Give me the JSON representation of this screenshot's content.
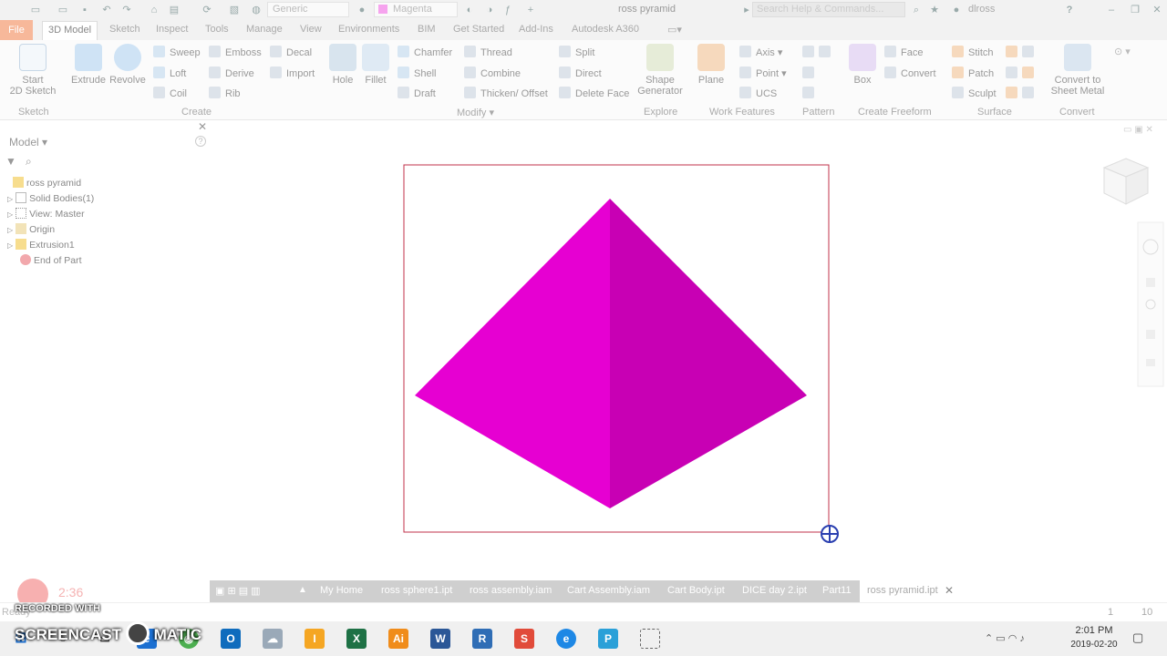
{
  "titlebar": {
    "appearance": "Generic",
    "material": "Magenta",
    "doc_title": "ross pyramid",
    "search_placeholder": "Search Help & Commands...",
    "user": "dlross",
    "help": "?"
  },
  "tabs": [
    "File",
    "3D Model",
    "Sketch",
    "Inspect",
    "Tools",
    "Manage",
    "View",
    "Environments",
    "BIM",
    "Get Started",
    "Add-Ins",
    "Autodesk A360"
  ],
  "ribbon": {
    "sketch": {
      "start_l1": "Start",
      "start_l2": "2D Sketch",
      "group": "Sketch"
    },
    "create": {
      "extrude": "Extrude",
      "revolve": "Revolve",
      "sweep": "Sweep",
      "loft": "Loft",
      "coil": "Coil",
      "emboss": "Emboss",
      "derive": "Derive",
      "rib": "Rib",
      "decal": "Decal",
      "import": "Import",
      "group": "Create"
    },
    "modify": {
      "hole": "Hole",
      "fillet": "Fillet",
      "chamfer": "Chamfer",
      "shell": "Shell",
      "draft": "Draft",
      "thread": "Thread",
      "combine": "Combine",
      "thicken": "Thicken/ Offset",
      "split": "Split",
      "direct": "Direct",
      "delete_face": "Delete Face",
      "group": "Modify"
    },
    "explore": {
      "shape_l1": "Shape",
      "shape_l2": "Generator",
      "group": "Explore"
    },
    "work": {
      "plane": "Plane",
      "axis": "Axis",
      "point": "Point",
      "ucs": "UCS",
      "group": "Work Features"
    },
    "pattern": {
      "group": "Pattern"
    },
    "freeform": {
      "box": "Box",
      "face": "Face",
      "convert": "Convert",
      "group": "Create Freeform"
    },
    "surface": {
      "stitch": "Stitch",
      "patch": "Patch",
      "sculpt": "Sculpt",
      "group": "Surface"
    },
    "convert": {
      "l1": "Convert to",
      "l2": "Sheet Metal",
      "group": "Convert"
    }
  },
  "browser": {
    "title": "Model",
    "nodes": [
      "ross pyramid",
      "Solid Bodies(1)",
      "View: Master",
      "Origin",
      "Extrusion1",
      "End of Part"
    ]
  },
  "colors": {
    "face_left": "#e600d2",
    "face_right": "#c800b4",
    "frame": "#c0304a"
  },
  "doc_tabs": [
    "My Home",
    "ross sphere1.ipt",
    "ross assembly.iam",
    "Cart Assembly.iam",
    "Cart Body.ipt",
    "DICE day 2.ipt",
    "Part11",
    "ross pyramid.ipt"
  ],
  "status": {
    "ready": "Ready",
    "n1": "1",
    "n2": "10"
  },
  "watermark": {
    "time": "2:36",
    "recorded": "RECORDED WITH",
    "brand_a": "SCREENCAST",
    "brand_b": "MATIC"
  },
  "clock": {
    "time": "2:01 PM",
    "date": "2019-02-20"
  }
}
